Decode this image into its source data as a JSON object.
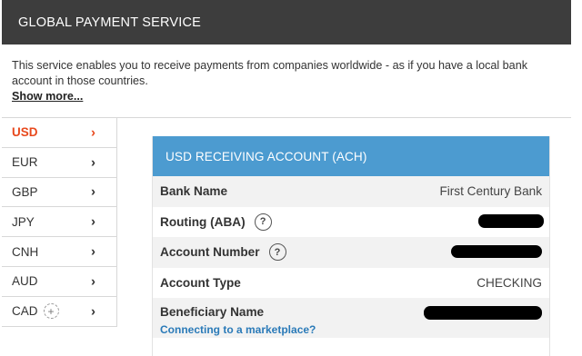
{
  "header": {
    "title": "GLOBAL PAYMENT SERVICE"
  },
  "intro": {
    "text": "This service enables you to receive payments from companies worldwide - as if you have a local bank account in those countries.",
    "show_more": "Show more..."
  },
  "currencies": [
    {
      "label": "USD",
      "active": true
    },
    {
      "label": "EUR",
      "active": false
    },
    {
      "label": "GBP",
      "active": false
    },
    {
      "label": "JPY",
      "active": false
    },
    {
      "label": "CNH",
      "active": false
    },
    {
      "label": "AUD",
      "active": false
    },
    {
      "label": "CAD",
      "active": false,
      "addable": true
    }
  ],
  "account": {
    "title": "USD RECEIVING ACCOUNT (ACH)",
    "rows": [
      {
        "label": "Bank Name",
        "value": "First Century Bank"
      },
      {
        "label": "Routing (ABA)",
        "value": ""
      },
      {
        "label": "Account Number",
        "value": ""
      },
      {
        "label": "Account Type",
        "value": "CHECKING"
      },
      {
        "label": "Beneficiary Name",
        "value": ""
      }
    ],
    "marketplace_link": "Connecting to a marketplace?"
  },
  "colors": {
    "header_bg": "#3d3d3d",
    "accent": "#e8491d",
    "panel_header_bg": "#4c9bd0",
    "link": "#2a7ab8"
  },
  "icons": {
    "chevron": "chevron-right-icon",
    "help": "question-circle-icon",
    "add": "plus-circle-icon"
  }
}
